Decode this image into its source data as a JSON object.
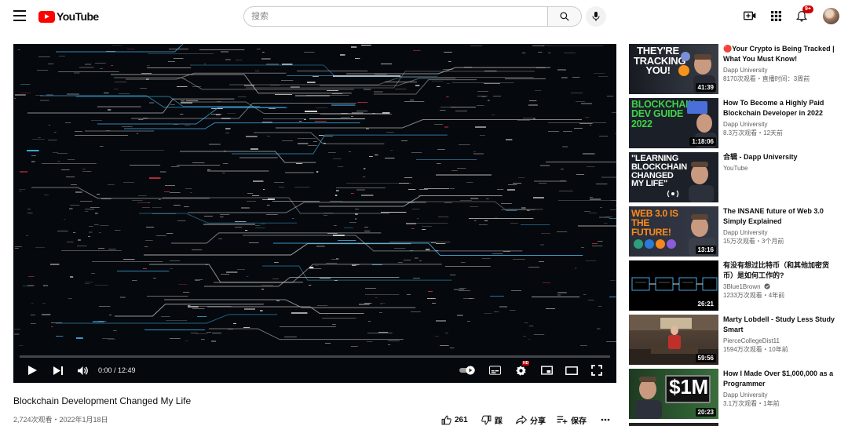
{
  "header": {
    "logo_text": "YouTube",
    "search_placeholder": "搜索",
    "notification_count": "9+"
  },
  "player": {
    "time": "0:00 / 12:49",
    "progress": 0
  },
  "video": {
    "title": "Blockchain Development Changed My Life",
    "meta": "2,724次观看・2022年1月18日",
    "like_count": "261",
    "dislike_label": "踩",
    "share_label": "分享",
    "save_label": "保存"
  },
  "sidebar": {
    "items": [
      {
        "title": "🔴Your Crypto is Being Tracked | What You Must Know!",
        "channel": "Dapp University",
        "stats": "8170次观看・直播时间：3周前",
        "duration": "41:39",
        "thumb_text": "THEY'RE TRACKING YOU!"
      },
      {
        "title": "How To Become a Highly Paid Blockchain Developer in 2022",
        "channel": "Dapp University",
        "stats": "8.3万次观看・12天前",
        "duration": "1:18:06",
        "thumb_text": "BLOCKCHAIN DEV GUIDE 2022"
      },
      {
        "title": "合辑 - Dapp University",
        "channel": "YouTube",
        "stats": "",
        "duration": "",
        "thumb_text": "\"LEARNING BLOCKCHAIN CHANGED MY LIFE\""
      },
      {
        "title": "The INSANE future of Web 3.0 Simply Explained",
        "channel": "Dapp University",
        "stats": "15万次观看・3个月前",
        "duration": "13:16",
        "thumb_text": "WEB 3.0 IS THE FUTURE!"
      },
      {
        "title": "有没有想过比特币（和其他加密货币）是如何工作的?",
        "channel": "3Blue1Brown",
        "stats": "1233万次观看・4年前",
        "duration": "26:21",
        "thumb_text": ""
      },
      {
        "title": "Marty Lobdell - Study Less Study Smart",
        "channel": "PierceCollegeDist11",
        "stats": "1594万次观看・10年前",
        "duration": "59:56",
        "thumb_text": ""
      },
      {
        "title": "How I Made Over $1,000,000 as a Programmer",
        "channel": "Dapp University",
        "stats": "3.1万次观看・1年前",
        "duration": "20:23",
        "thumb_text": "$1M"
      }
    ]
  },
  "colors": {
    "brand_red": "#ff0000",
    "badge_red": "#cc0000",
    "meta_gray": "#606060",
    "thumb_yellow": "#f5d300",
    "thumb_green": "#3fd24a",
    "thumb_orange": "#ff8c1a"
  }
}
